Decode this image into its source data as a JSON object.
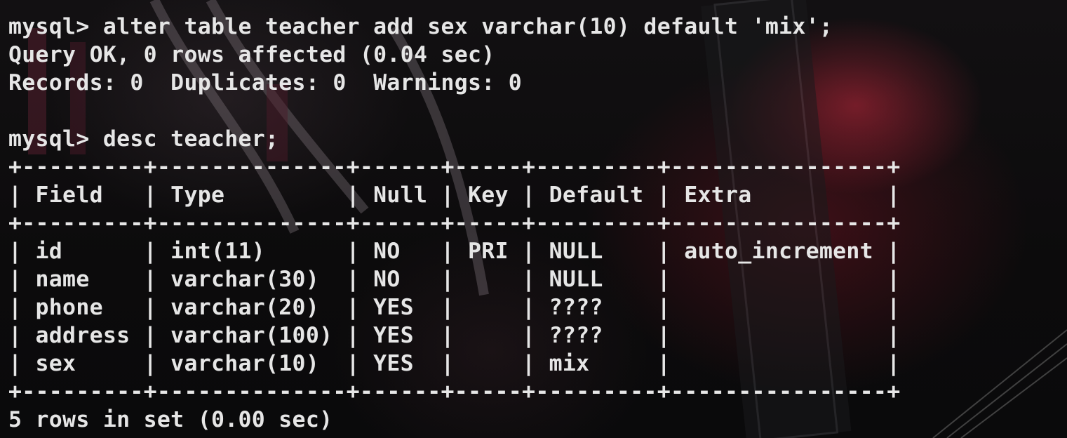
{
  "terminal": {
    "lines": [
      "mysql> alter table teacher add sex varchar(10) default 'mix';",
      "Query OK, 0 rows affected (0.04 sec)",
      "Records: 0  Duplicates: 0  Warnings: 0",
      "",
      "mysql> desc teacher;",
      "+---------+--------------+------+-----+---------+----------------+",
      "| Field   | Type         | Null | Key | Default | Extra          |",
      "+---------+--------------+------+-----+---------+----------------+",
      "| id      | int(11)      | NO   | PRI | NULL    | auto_increment |",
      "| name    | varchar(30)  | NO   |     | NULL    |                |",
      "| phone   | varchar(20)  | YES  |     | ????    |                |",
      "| address | varchar(100) | YES  |     | ????    |                |",
      "| sex     | varchar(10)  | YES  |     | mix     |                |",
      "+---------+--------------+------+-----+---------+----------------+",
      "5 rows in set (0.00 sec)"
    ]
  },
  "colors": {
    "text": "#e6e6e6",
    "background": "#0b0b0c",
    "accent": "#b8283c"
  }
}
